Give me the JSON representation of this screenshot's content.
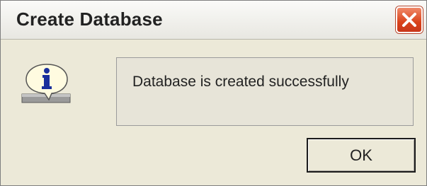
{
  "window": {
    "title": "Create Database"
  },
  "dialog": {
    "icon": "info-icon",
    "message": "Database is created successfully",
    "ok_label": "OK"
  },
  "colors": {
    "close_button": "#d9421a",
    "info_blue": "#1a2f9c"
  }
}
